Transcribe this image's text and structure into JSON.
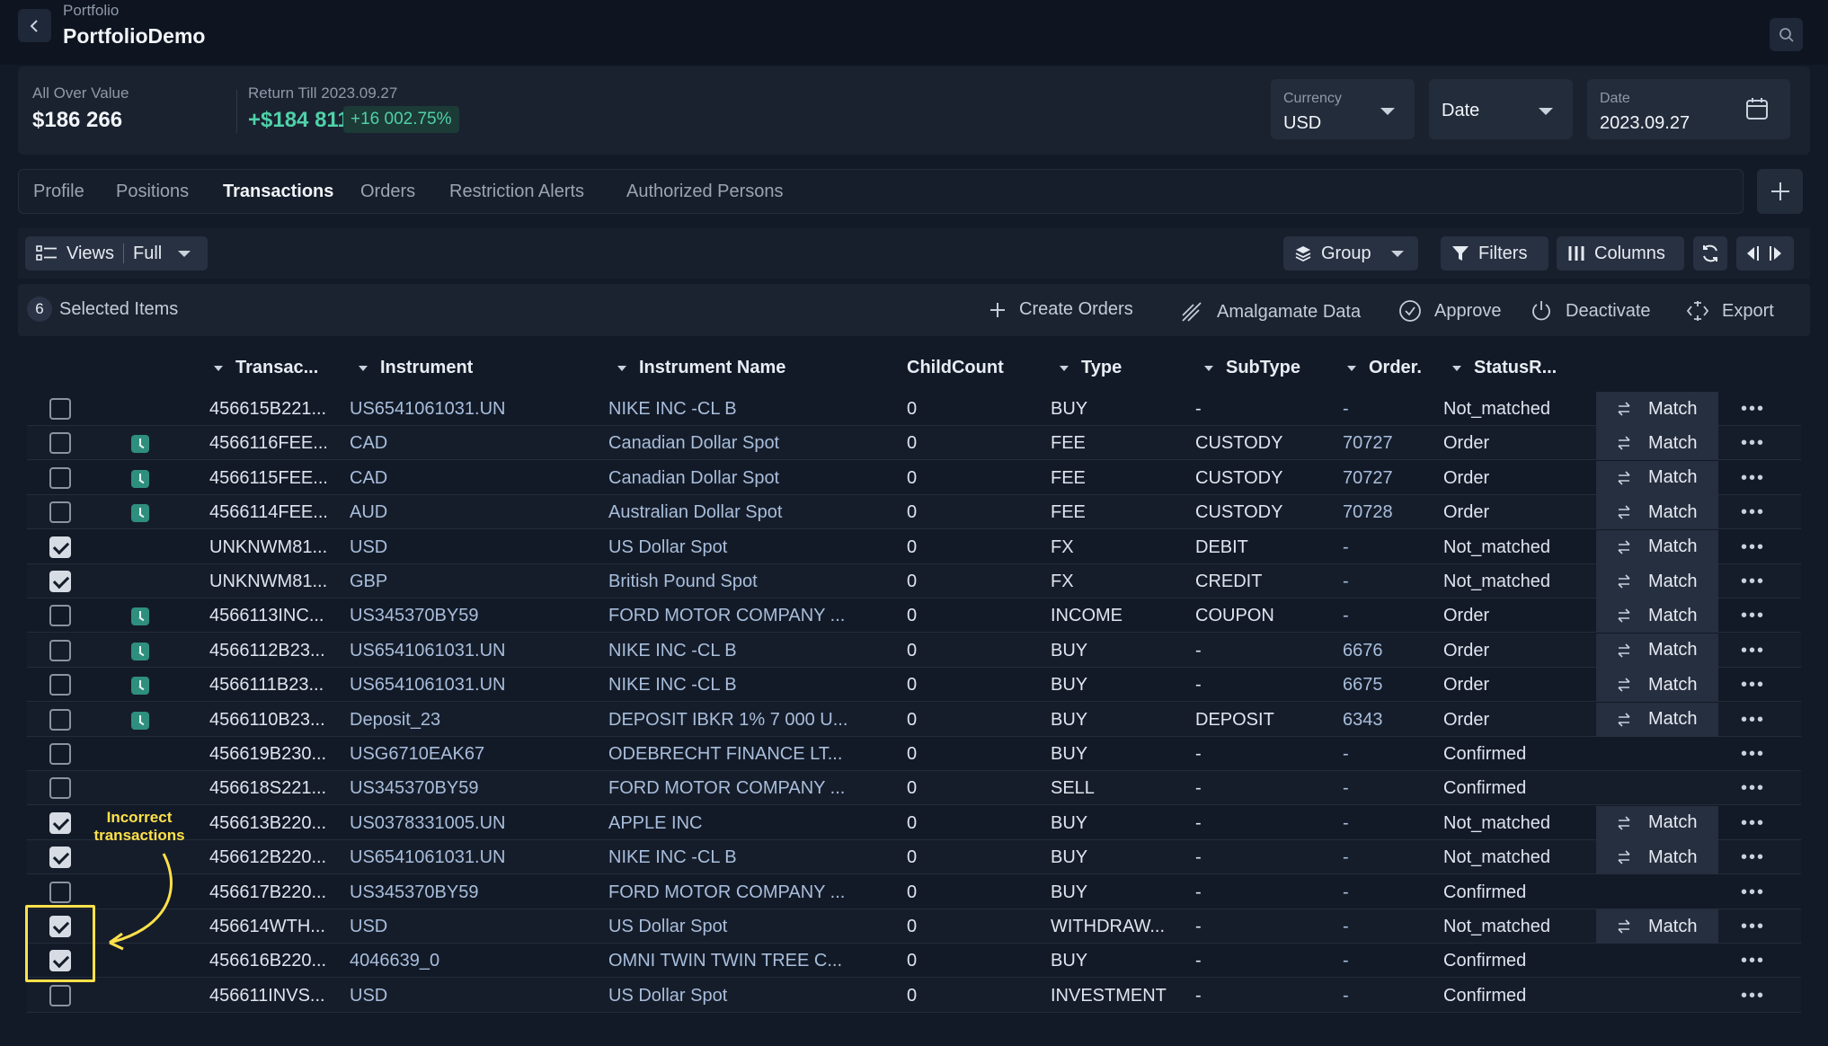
{
  "header": {
    "breadcrumb": "Portfolio",
    "title": "PortfolioDemo"
  },
  "summary": {
    "all_over_value_label": "All Over Value",
    "all_over_value": "$186 266",
    "return_label": "Return Till 2023.09.27",
    "return_value": "+$184 811",
    "return_pct": "+16 002.75%",
    "currency_label": "Currency",
    "currency_value": "USD",
    "date_select_value": "Date",
    "date_label": "Date",
    "date_value": "2023.09.27"
  },
  "tabs": [
    "Profile",
    "Positions",
    "Transactions",
    "Orders",
    "Restriction Alerts",
    "Authorized Persons"
  ],
  "active_tab": "Transactions",
  "toolbar": {
    "views_label": "Views",
    "views_value": "Full",
    "group_label": "Group",
    "filters_label": "Filters",
    "columns_label": "Columns"
  },
  "selection": {
    "count": "6",
    "label": "Selected Items",
    "actions": [
      "Create Orders",
      "Amalgamate Data",
      "Approve",
      "Deactivate",
      "Export"
    ]
  },
  "table": {
    "columns": [
      "Transac...",
      "Instrument",
      "Instrument Name",
      "ChildCount",
      "Type",
      "SubType",
      "Order.",
      "StatusR..."
    ],
    "match_label": "Match",
    "rows": [
      {
        "checked": false,
        "clock": false,
        "id": "456615B221...",
        "instrument": "US6541061031.UN",
        "name": "NIKE INC -CL B",
        "child": "0",
        "type": "BUY",
        "subtype": "-",
        "order": "-",
        "status": "Not_matched",
        "match": true
      },
      {
        "checked": false,
        "clock": true,
        "id": "4566116FEE...",
        "instrument": "CAD",
        "name": "Canadian Dollar Spot",
        "child": "0",
        "type": "FEE",
        "subtype": "CUSTODY",
        "order": "70727",
        "status": "Order",
        "match": true
      },
      {
        "checked": false,
        "clock": true,
        "id": "4566115FEE...",
        "instrument": "CAD",
        "name": "Canadian Dollar Spot",
        "child": "0",
        "type": "FEE",
        "subtype": "CUSTODY",
        "order": "70727",
        "status": "Order",
        "match": true
      },
      {
        "checked": false,
        "clock": true,
        "id": "4566114FEE...",
        "instrument": "AUD",
        "name": "Australian Dollar Spot",
        "child": "0",
        "type": "FEE",
        "subtype": "CUSTODY",
        "order": "70728",
        "status": "Order",
        "match": true
      },
      {
        "checked": true,
        "clock": false,
        "id": "UNKNWM81...",
        "instrument": "USD",
        "name": "US Dollar Spot",
        "child": "0",
        "type": "FX",
        "subtype": "DEBIT",
        "order": "-",
        "status": "Not_matched",
        "match": true
      },
      {
        "checked": true,
        "clock": false,
        "id": "UNKNWM81...",
        "instrument": "GBP",
        "name": "British Pound Spot",
        "child": "0",
        "type": "FX",
        "subtype": "CREDIT",
        "order": "-",
        "status": "Not_matched",
        "match": true
      },
      {
        "checked": false,
        "clock": true,
        "id": "4566113INC...",
        "instrument": "US345370BY59",
        "name": "FORD MOTOR COMPANY ...",
        "child": "0",
        "type": "INCOME",
        "subtype": "COUPON",
        "order": "-",
        "status": "Order",
        "match": true
      },
      {
        "checked": false,
        "clock": true,
        "id": "4566112B23...",
        "instrument": "US6541061031.UN",
        "name": "NIKE INC -CL B",
        "child": "0",
        "type": "BUY",
        "subtype": "-",
        "order": "6676",
        "status": "Order",
        "match": true
      },
      {
        "checked": false,
        "clock": true,
        "id": "4566111B23...",
        "instrument": "US6541061031.UN",
        "name": "NIKE INC -CL B",
        "child": "0",
        "type": "BUY",
        "subtype": "-",
        "order": "6675",
        "status": "Order",
        "match": true
      },
      {
        "checked": false,
        "clock": true,
        "id": "4566110B23...",
        "instrument": "Deposit_23",
        "name": "DEPOSIT IBKR 1% 7 000 U...",
        "child": "0",
        "type": "BUY",
        "subtype": "DEPOSIT",
        "order": "6343",
        "status": "Order",
        "match": true
      },
      {
        "checked": false,
        "clock": false,
        "id": "456619B230...",
        "instrument": "USG6710EAK67",
        "name": "ODEBRECHT FINANCE LT...",
        "child": "0",
        "type": "BUY",
        "subtype": "-",
        "order": "-",
        "status": "Confirmed",
        "match": false
      },
      {
        "checked": false,
        "clock": false,
        "id": "456618S221...",
        "instrument": "US345370BY59",
        "name": "FORD MOTOR COMPANY ...",
        "child": "0",
        "type": "SELL",
        "subtype": "-",
        "order": "-",
        "status": "Confirmed",
        "match": false
      },
      {
        "checked": true,
        "clock": false,
        "id": "456613B220...",
        "instrument": "US0378331005.UN",
        "name": "APPLE INC",
        "child": "0",
        "type": "BUY",
        "subtype": "-",
        "order": "-",
        "status": "Not_matched",
        "match": true
      },
      {
        "checked": true,
        "clock": false,
        "id": "456612B220...",
        "instrument": "US6541061031.UN",
        "name": "NIKE INC -CL B",
        "child": "0",
        "type": "BUY",
        "subtype": "-",
        "order": "-",
        "status": "Not_matched",
        "match": true
      },
      {
        "checked": false,
        "clock": false,
        "id": "456617B220...",
        "instrument": "US345370BY59",
        "name": "FORD MOTOR COMPANY ...",
        "child": "0",
        "type": "BUY",
        "subtype": "-",
        "order": "-",
        "status": "Confirmed",
        "match": false
      },
      {
        "checked": true,
        "clock": false,
        "id": "456614WTH...",
        "instrument": "USD",
        "name": "US Dollar Spot",
        "child": "0",
        "type": "WITHDRAW...",
        "subtype": "-",
        "order": "-",
        "status": "Not_matched",
        "match": true
      },
      {
        "checked": true,
        "clock": false,
        "id": "456616B220...",
        "instrument": "4046639_0",
        "name": "OMNI TWIN TWIN TREE C...",
        "child": "0",
        "type": "BUY",
        "subtype": "-",
        "order": "-",
        "status": "Confirmed",
        "match": false
      },
      {
        "checked": false,
        "clock": false,
        "id": "456611INVS...",
        "instrument": "USD",
        "name": "US Dollar Spot",
        "child": "0",
        "type": "INVESTMENT",
        "subtype": "-",
        "order": "-",
        "status": "Confirmed",
        "match": false
      }
    ]
  },
  "annotation": {
    "text_line1": "Incorrect",
    "text_line2": "transactions"
  },
  "colors": {
    "accent_green": "#4fd1a8",
    "annotation_yellow": "#ffe14a",
    "clock_teal": "#2f8f7f"
  }
}
